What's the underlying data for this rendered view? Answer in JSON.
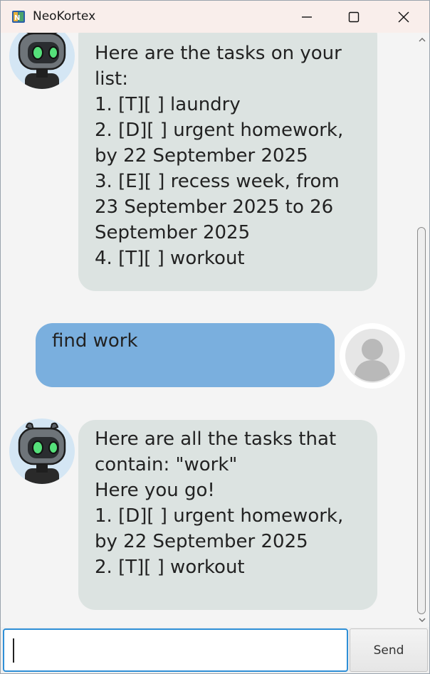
{
  "window": {
    "title": "NeoKortex"
  },
  "messages": [
    {
      "sender": "bot",
      "lines": [
        "Here are the tasks on your",
        "list:",
        "1. [T][ ] laundry",
        "2. [D][ ] urgent homework,",
        "by 22 September 2025",
        "3. [E][ ] recess week, from",
        "23 September 2025 to 26",
        "September 2025",
        "4. [T][ ] workout"
      ]
    },
    {
      "sender": "user",
      "lines": [
        "find work"
      ]
    },
    {
      "sender": "bot",
      "lines": [
        "Here are all the tasks that",
        "contain: \"work\"",
        "Here you go!",
        "1. [D][ ] urgent homework,",
        "by 22 September 2025",
        "2. [T][ ] workout"
      ]
    }
  ],
  "input": {
    "value": "",
    "placeholder": ""
  },
  "send_button": {
    "label": "Send"
  },
  "colors": {
    "bot_bubble": "#dce3e1",
    "user_bubble": "#7aafde",
    "input_focus": "#2f8fd6",
    "titlebar": "#f9eeeb"
  },
  "icons": {
    "app": "app-logo-icon",
    "bot_avatar": "robot-avatar-icon",
    "user_avatar": "user-silhouette-icon"
  }
}
